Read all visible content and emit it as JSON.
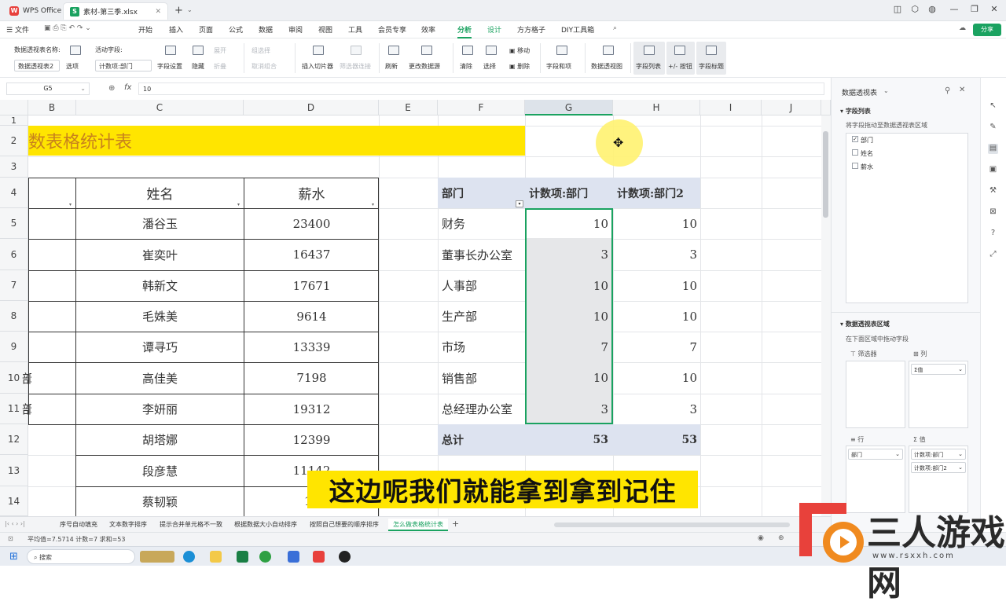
{
  "titlebar": {
    "app_tab": "WPS Office",
    "file_tab": "素材-第三季.xlsx",
    "add_tab": "+"
  },
  "menubar": {
    "file": "文件",
    "items": [
      "开始",
      "插入",
      "页面",
      "公式",
      "数据",
      "审阅",
      "视图",
      "工具",
      "会员专享",
      "效率",
      "分析",
      "设计",
      "方方格子",
      "DIY工具箱"
    ],
    "active": "分析",
    "share": "分享"
  },
  "ribbon": {
    "pivot_name_label": "数据透视表名称:",
    "pivot_name_value": "数据透视表2",
    "options": "选项",
    "active_field_label": "活动字段:",
    "active_field_value": "计数项:部门",
    "field_settings": "字段设置",
    "hide": "隐藏",
    "expand": "展开",
    "collapse": "折叠",
    "group_select": "组选择",
    "ungroup": "取消组合",
    "insert_slicer": "插入切片器",
    "insert_timeline": "筛选器连接",
    "refresh": "刷新",
    "change_source": "更改数据源",
    "clear": "清除",
    "select": "选择",
    "move": "移动",
    "delete": "删除",
    "fields_items": "字段和项",
    "pivot_chart": "数据透视图",
    "field_list": "字段列表",
    "plus_minus": "+/- 按钮",
    "field_headers": "字段标题"
  },
  "formulabar": {
    "cell_ref": "G5",
    "fx": "fx",
    "value": "10"
  },
  "grid": {
    "columns": [
      "B",
      "C",
      "D",
      "E",
      "F",
      "G",
      "H",
      "I",
      "J"
    ],
    "rows": [
      "1",
      "2",
      "3",
      "4",
      "5",
      "6",
      "7",
      "8",
      "9",
      "10",
      "11",
      "12",
      "13",
      "14"
    ],
    "title": "数表格统计表",
    "header_name": "姓名",
    "header_salary": "薪水",
    "names": [
      "潘谷玉",
      "崔奕叶",
      "韩新文",
      "毛姝美",
      "谭寻巧",
      "高佳美",
      "李妍丽",
      "胡塔娜",
      "段彦慧",
      "蔡韧颖"
    ],
    "salaries": [
      "23400",
      "16437",
      "17671",
      "9614",
      "13339",
      "7198",
      "19312",
      "12399",
      "11142",
      "13"
    ],
    "b_fragments": [
      "",
      "",
      "",
      "",
      "",
      "部",
      "部",
      "",
      "",
      ""
    ]
  },
  "pivot": {
    "header_dept": "部门",
    "header_count1": "计数项:部门",
    "header_count2": "计数项:部门2",
    "rows": [
      {
        "dept": "财务",
        "c1": "10",
        "c2": "10"
      },
      {
        "dept": "董事长办公室",
        "c1": "3",
        "c2": "3"
      },
      {
        "dept": "人事部",
        "c1": "10",
        "c2": "10"
      },
      {
        "dept": "生产部",
        "c1": "10",
        "c2": "10"
      },
      {
        "dept": "市场",
        "c1": "7",
        "c2": "7"
      },
      {
        "dept": "销售部",
        "c1": "10",
        "c2": "10"
      },
      {
        "dept": "总经理办公室",
        "c1": "3",
        "c2": "3"
      }
    ],
    "total_label": "总计",
    "total1": "53",
    "total2": "53"
  },
  "rightpane": {
    "title": "数据透视表",
    "field_list_section": "字段列表",
    "drag_hint": "将字段拖动至数据透视表区域",
    "fields": [
      {
        "label": "部门",
        "checked": true
      },
      {
        "label": "姓名",
        "checked": false
      },
      {
        "label": "薪水",
        "checked": false
      }
    ],
    "areas_section": "数据透视表区域",
    "areas_hint": "在下面区域中拖动字段",
    "filter_label": "筛选器",
    "columns_label": "列",
    "columns_value": "Σ值",
    "rows_label": "行",
    "values_label": "值",
    "rows_value": "部门",
    "values_items": [
      "计数项:部门",
      "计数项:部门2"
    ]
  },
  "sheettabs": {
    "tabs": [
      "序号自动填充",
      "文本数字排序",
      "提示合并单元格不一致",
      "根据数据大小自动排序",
      "按照自己想要的顺序排序",
      "怎么做表格统计表"
    ],
    "active_index": 5,
    "add": "+"
  },
  "statusbar": {
    "stats": "平均值=7.5714  计数=7  求和=53"
  },
  "taskbar": {
    "search": "搜索"
  },
  "subtitle": "这边呢我们就能拿到拿到记住",
  "watermark": {
    "text": "三人游戏网",
    "url": "www.rsxxh.com"
  },
  "colors": {
    "accent": "#1aa260",
    "title_fill": "#ffe500",
    "pivot_header": "#dde3f0",
    "subtitle_bg": "#ffe500",
    "watermark_red": "#e8413b"
  }
}
